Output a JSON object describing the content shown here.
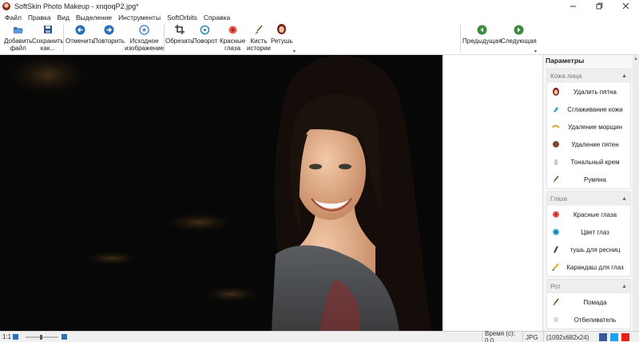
{
  "window": {
    "title": "SoftSkin Photo Makeup - xnqoqP2.jpg*"
  },
  "menu": [
    "Файл",
    "Правка",
    "Вид",
    "Выделение",
    "Инструменты",
    "SoftOrbits",
    "Справка"
  ],
  "toolbar": {
    "add_file": [
      "Добавить",
      "файл"
    ],
    "save_as": [
      "Сохранить",
      "как..."
    ],
    "undo": "Отменить",
    "redo": "Повторить",
    "original": [
      "Исходное",
      "изображение"
    ],
    "crop": "Обрезать",
    "rotate": "Поворот",
    "red_eyes": [
      "Красные",
      "глаза"
    ],
    "brush_history": [
      "Кисть",
      "истории"
    ],
    "retouch": "Ретушь",
    "previous": "Предыдущая",
    "next": "Следующая"
  },
  "panel": {
    "title": "Параметры",
    "sections": [
      {
        "name": "Кожа лица",
        "items": [
          {
            "label": "Удалить пятна",
            "icon": "face-icon"
          },
          {
            "label": "Сглаживание кожи",
            "icon": "smooth-skin-icon"
          },
          {
            "label": "Удаление морщин",
            "icon": "wrinkle-icon"
          },
          {
            "label": "Удаление пятен",
            "icon": "spot-icon"
          },
          {
            "label": "Тональный крем",
            "icon": "foundation-icon"
          },
          {
            "label": "Румяна",
            "icon": "blush-brush-icon"
          }
        ]
      },
      {
        "name": "Глаза",
        "items": [
          {
            "label": "Красные глаза",
            "icon": "red-eye-icon"
          },
          {
            "label": "Цвет глаз",
            "icon": "eye-color-icon"
          },
          {
            "label": "тушь для ресниц",
            "icon": "mascara-icon"
          },
          {
            "label": "Карандаш для глаз",
            "icon": "eye-pencil-icon"
          }
        ]
      },
      {
        "name": "Рот",
        "items": [
          {
            "label": "Помада",
            "icon": "lipstick-icon"
          },
          {
            "label": "Отбеливатель",
            "icon": "whitener-icon"
          }
        ]
      }
    ]
  },
  "status": {
    "zoom_ratio": "1:1",
    "time": "Время (с): 0.0",
    "format": "JPG",
    "dimensions": "(1092x682x24)"
  },
  "colors": {
    "accent_blue": "#2a6fb7",
    "nav_green": "#3b8c3b",
    "photo_bg": "#070707"
  }
}
